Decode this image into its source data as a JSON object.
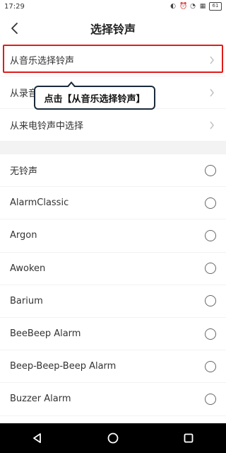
{
  "status": {
    "time": "17:29",
    "battery": "61"
  },
  "header": {
    "title": "选择铃声"
  },
  "menu": {
    "items": [
      {
        "label": "从音乐选择铃声"
      },
      {
        "label": "从录音"
      },
      {
        "label": "从来电铃声中选择"
      }
    ]
  },
  "tooltip": {
    "text": "点击【从音乐选择铃声】"
  },
  "ringtones": [
    {
      "label": "无铃声"
    },
    {
      "label": "AlarmClassic"
    },
    {
      "label": "Argon"
    },
    {
      "label": "Awoken"
    },
    {
      "label": "Barium"
    },
    {
      "label": "BeeBeep Alarm"
    },
    {
      "label": "Beep-Beep-Beep Alarm"
    },
    {
      "label": "Buzzer Alarm"
    }
  ]
}
